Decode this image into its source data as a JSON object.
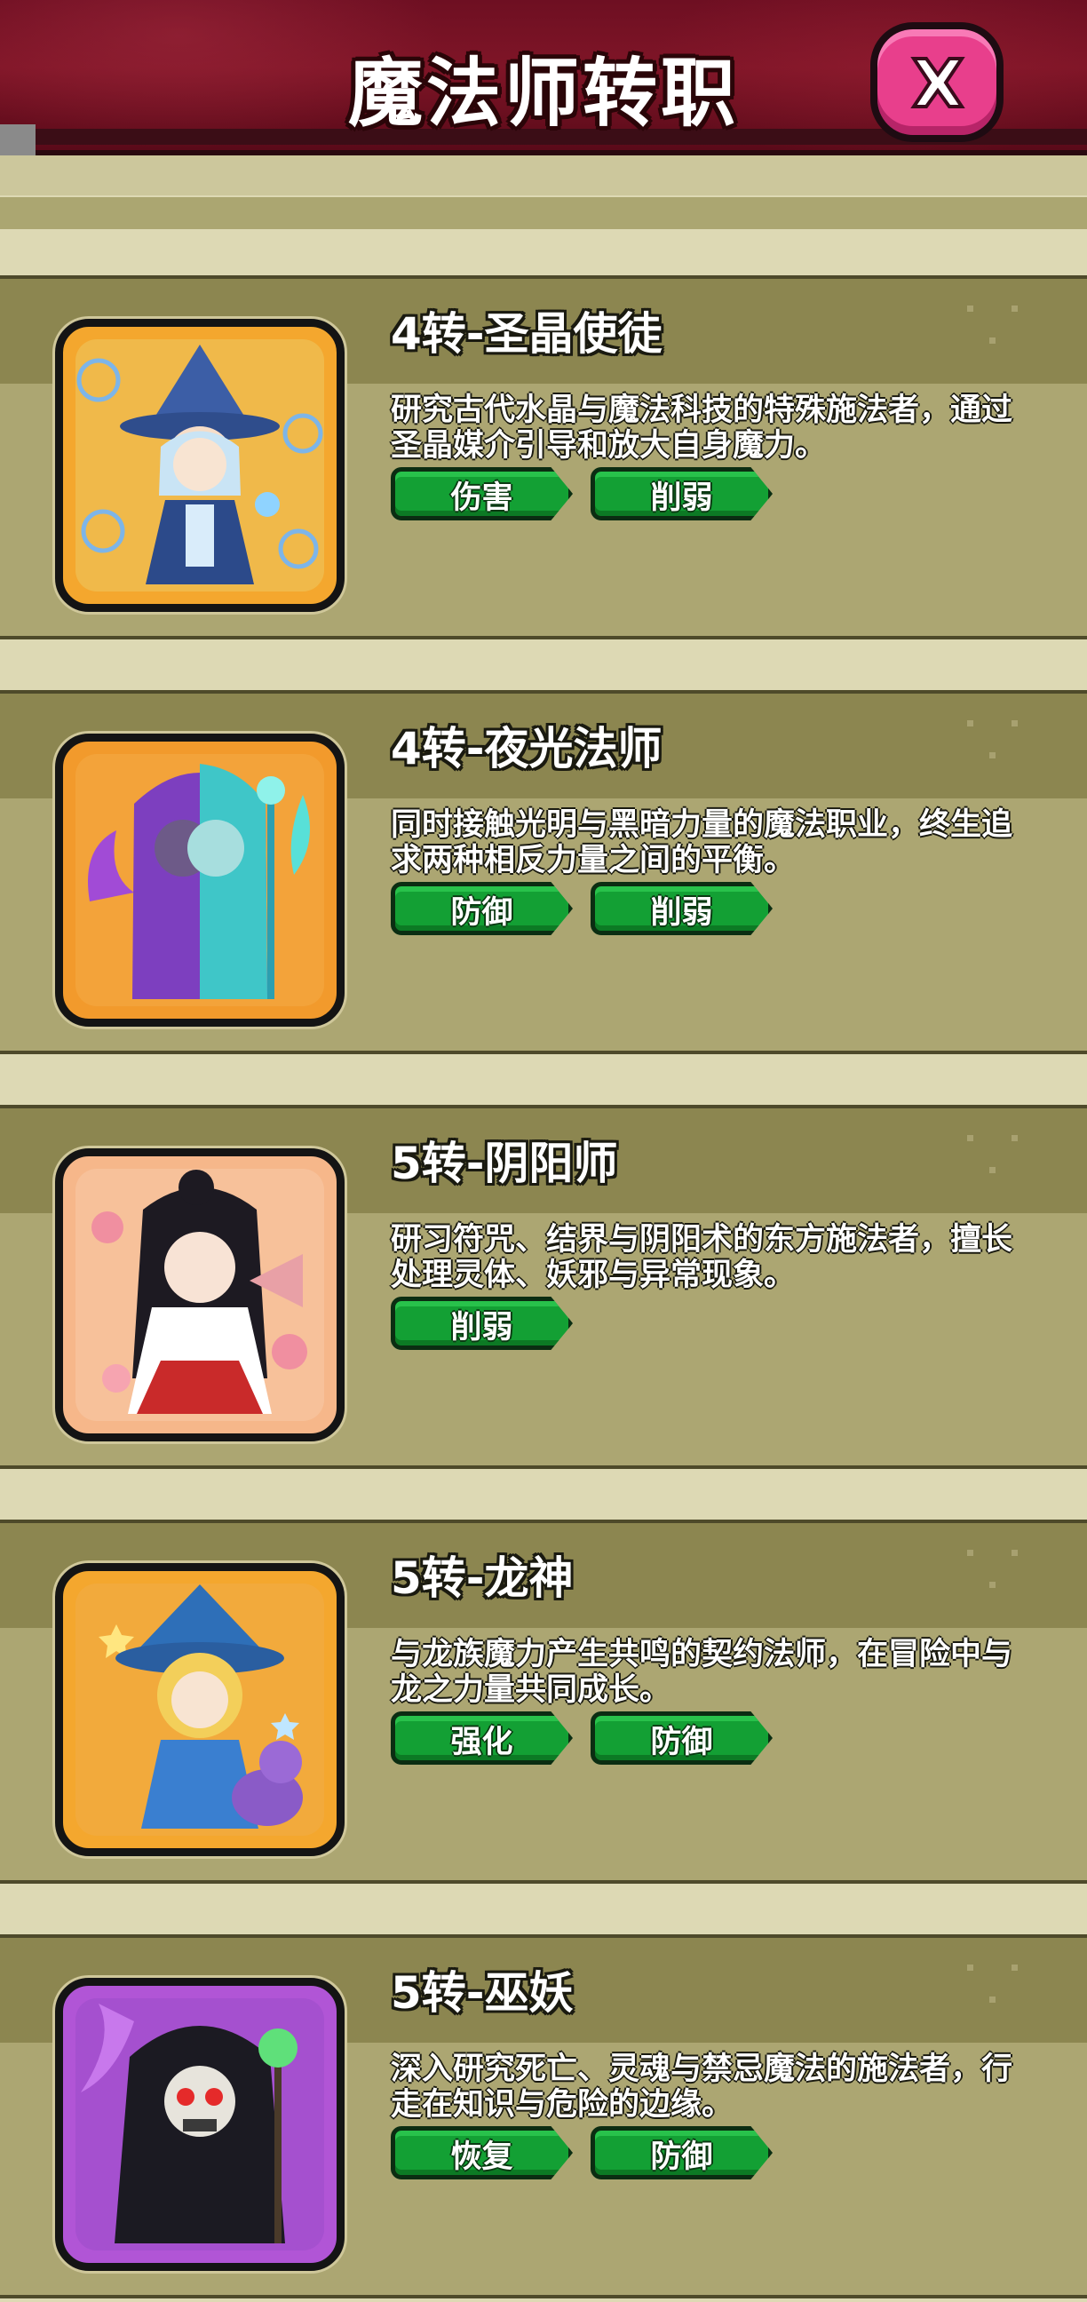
{
  "header": {
    "title": "魔法师转职"
  },
  "classes": [
    {
      "name": "4转-圣晶使徒",
      "description": "研究古代水晶与魔法科技的特殊施法者，通过圣晶媒介引导和放大自身魔力。",
      "tags": [
        "伤害",
        "削弱"
      ]
    },
    {
      "name": "4转-夜光法师",
      "description": "同时接触光明与黑暗力量的魔法职业，终生追求两种相反力量之间的平衡。",
      "tags": [
        "防御",
        "削弱"
      ]
    },
    {
      "name": "5转-阴阳师",
      "description": "研习符咒、结界与阴阳术的东方施法者，擅长处理灵体、妖邪与异常现象。",
      "tags": [
        "削弱"
      ]
    },
    {
      "name": "5转-龙神",
      "description": "与龙族魔力产生共鸣的契约法师，在冒险中与龙之力量共同成长。",
      "tags": [
        "强化",
        "防御"
      ]
    },
    {
      "name": "5转-巫妖",
      "description": "深入研究死亡、灵魂与禁忌魔法的施法者，行走在知识与危险的边缘。",
      "tags": [
        "恢复",
        "防御"
      ]
    }
  ],
  "icons": {
    "close": "close-x-icon",
    "portraits": [
      "crystal-mage-portrait",
      "twilight-mage-portrait",
      "onmyoji-portrait",
      "dragon-mage-portrait",
      "lich-portrait"
    ]
  },
  "colors": {
    "header_bg": "#7f1527",
    "close_button": "#e83f8c",
    "card_bg": "#aca672",
    "card_head": "#8c8650",
    "tag_green": "#13a034",
    "portrait_bg": "#f4a72e"
  }
}
